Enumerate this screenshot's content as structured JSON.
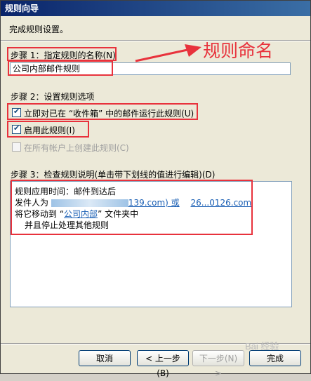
{
  "window": {
    "title": "规则向导"
  },
  "intro": "完成规则设置。",
  "step1": {
    "label": "步骤 1：指定规则的名称(N)",
    "name_value": "公司内部邮件规则"
  },
  "annotation": {
    "text": "规则命名"
  },
  "step2": {
    "label": "步骤 2：设置规则选项",
    "options": [
      {
        "label": "立即对已在 “收件箱” 中的邮件运行此规则(U)",
        "checked": true
      },
      {
        "label": "启用此规则(I)",
        "checked": true
      },
      {
        "label": "在所有帐户上创建此规则(C)",
        "checked": false
      }
    ]
  },
  "step3": {
    "label": "步骤 3：检查规则说明(单击带下划线的值进行编辑)(D)",
    "lines": {
      "line1": "规则应用时间：邮件到达后",
      "line2_prefix": "发件人为 ",
      "line2_link1": "139.com) 或",
      "line2_link2": "26...0126.com",
      "line3_prefix": "将它移动到 “",
      "line3_link": "公司内部",
      "line3_suffix": "” 文件夹中",
      "line4": "并且停止处理其他规则"
    }
  },
  "buttons": {
    "cancel": "取消",
    "back": "< 上一步(B)",
    "next": "下一步(N) >",
    "finish": "完成"
  },
  "watermark": "Bai 经验"
}
